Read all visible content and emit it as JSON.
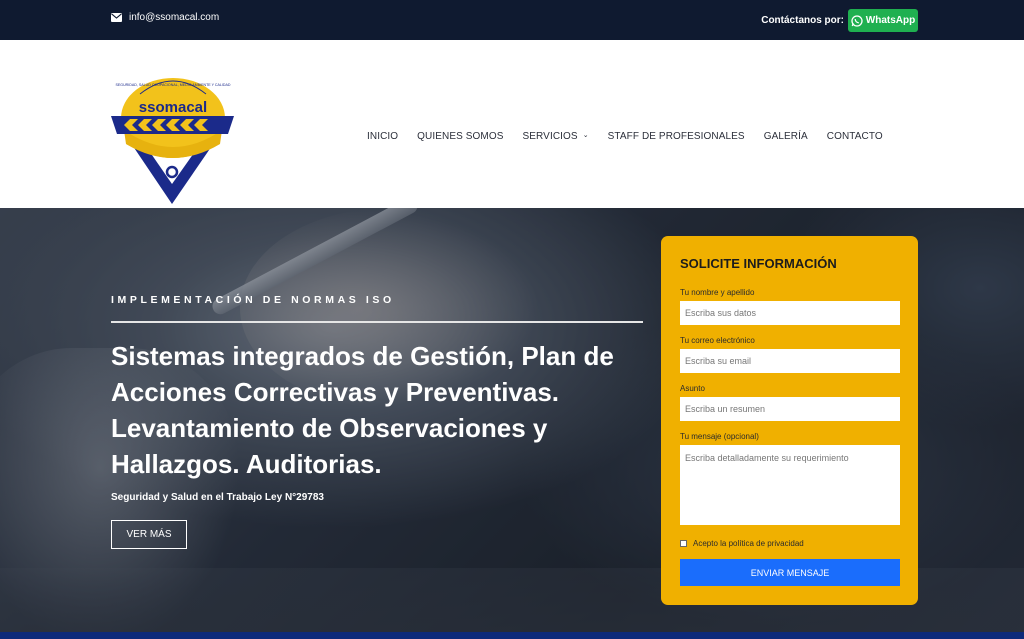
{
  "topbar": {
    "email": "info@ssomacal.com",
    "email_icon": "envelope-icon",
    "contact_label": "Contáctanos por:",
    "whatsapp_label": "WhatsApp",
    "whatsapp_icon": "whatsapp-icon"
  },
  "logo": {
    "brand": "ssomacal",
    "ring_text": "SEGURIDAD, SALUD OCUPACIONAL, MEDIO AMBIENTE Y CALIDAD"
  },
  "nav": {
    "items": [
      {
        "label": "INICIO"
      },
      {
        "label": "QUIENES SOMOS"
      },
      {
        "label": "SERVICIOS",
        "has_dropdown": true
      },
      {
        "label": "STAFF DE PROFESIONALES"
      },
      {
        "label": "GALERÍA"
      },
      {
        "label": "CONTACTO"
      }
    ]
  },
  "hero": {
    "eyebrow": "IMPLEMENTACIÓN DE NORMAS ISO",
    "headline": "Sistemas integrados de Gestión, Plan de Acciones Correctivas y Preventivas. Levantamiento de Observaciones y Hallazgos. Auditorias.",
    "subtitle": "Seguridad y Salud en el Trabajo Ley N°29783",
    "button_label": "VER MÁS"
  },
  "form": {
    "title": "SOLICITE INFORMACIÓN",
    "name_label": "Tu nombre y apellido",
    "name_placeholder": "Escriba sus datos",
    "email_label": "Tu correo electrónico",
    "email_placeholder": "Escriba su email",
    "subject_label": "Asunto",
    "subject_placeholder": "Escriba un resumen",
    "message_label": "Tu mensaje (opcional)",
    "message_placeholder": "Escriba detalladamente su requerimiento",
    "privacy_label": "Acepto la política de privacidad",
    "submit_label": "ENVIAR MENSAJE"
  },
  "colors": {
    "topbar_bg": "#0f1a30",
    "whatsapp_green": "#1fb050",
    "card_yellow": "#f0b000",
    "submit_blue": "#1a6dfc",
    "logo_navy": "#1b2a8a",
    "logo_yellow": "#f2c21b"
  }
}
